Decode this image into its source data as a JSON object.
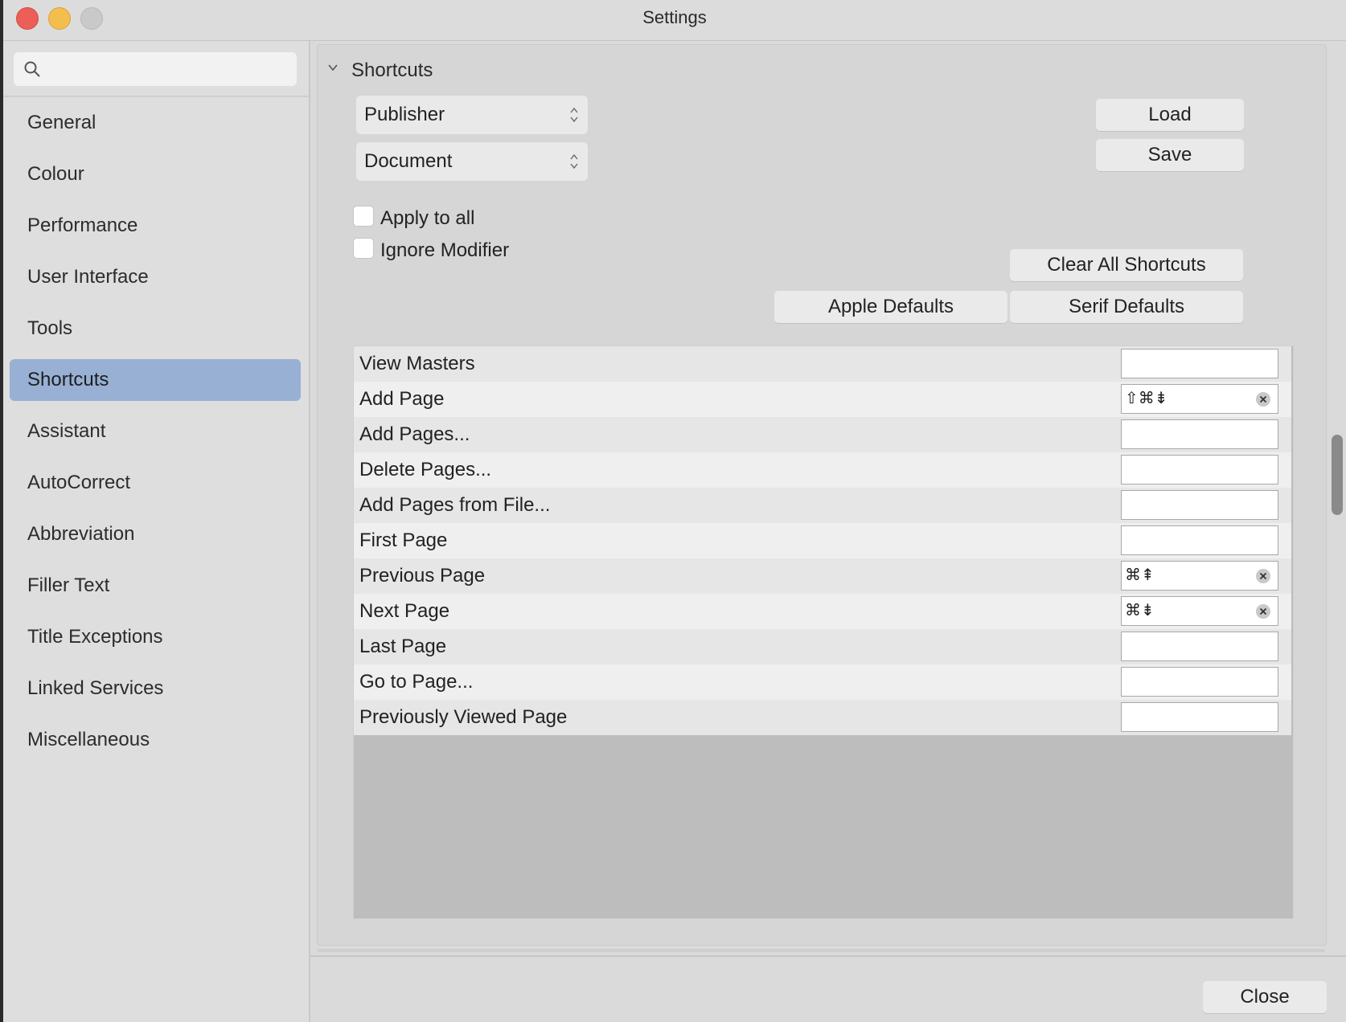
{
  "window": {
    "title": "Settings"
  },
  "sidebar": {
    "search": {
      "placeholder": ""
    },
    "items": [
      {
        "label": "General"
      },
      {
        "label": "Colour"
      },
      {
        "label": "Performance"
      },
      {
        "label": "User Interface"
      },
      {
        "label": "Tools"
      },
      {
        "label": "Shortcuts",
        "active": true
      },
      {
        "label": "Assistant"
      },
      {
        "label": "AutoCorrect"
      },
      {
        "label": "Abbreviation"
      },
      {
        "label": "Filler Text"
      },
      {
        "label": "Title Exceptions"
      },
      {
        "label": "Linked Services"
      },
      {
        "label": "Miscellaneous"
      }
    ]
  },
  "main": {
    "section_title": "Shortcuts",
    "app_select": "Publisher",
    "context_select": "Document",
    "apply_to_all": "Apply to all",
    "ignore_modifier": "Ignore Modifier",
    "buttons": {
      "load": "Load",
      "save": "Save",
      "clear_all": "Clear All Shortcuts",
      "apple_defaults": "Apple Defaults",
      "serif_defaults": "Serif Defaults",
      "close": "Close"
    },
    "shortcuts": [
      {
        "label": "View Masters",
        "key": ""
      },
      {
        "label": "Add Page",
        "key": "⇧⌘⇟"
      },
      {
        "label": "Add Pages...",
        "key": ""
      },
      {
        "label": "Delete Pages...",
        "key": ""
      },
      {
        "label": "Add Pages from File...",
        "key": ""
      },
      {
        "label": "First Page",
        "key": ""
      },
      {
        "label": "Previous Page",
        "key": "⌘⇞"
      },
      {
        "label": "Next Page",
        "key": "⌘⇟"
      },
      {
        "label": "Last Page",
        "key": ""
      },
      {
        "label": "Go to Page...",
        "key": ""
      },
      {
        "label": "Previously Viewed Page",
        "key": ""
      }
    ]
  },
  "colors": {
    "active_item": "#97b0d4",
    "close_light": "#ec5f59",
    "minimize_light": "#f4be4f"
  }
}
